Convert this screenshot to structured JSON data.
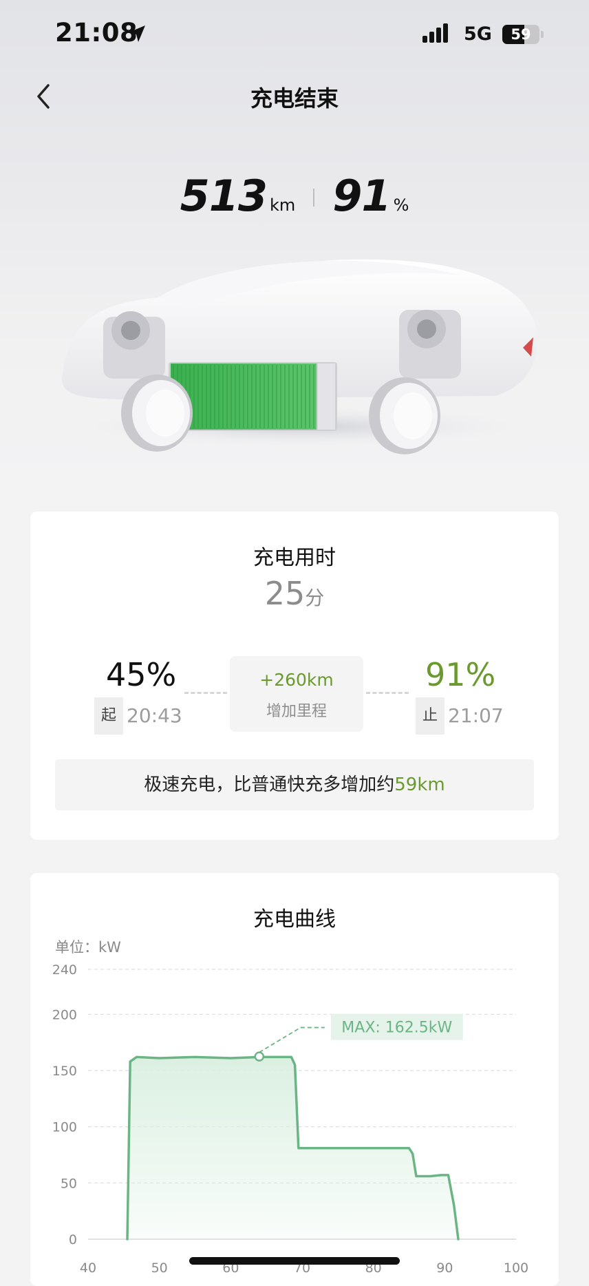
{
  "status_bar": {
    "time": "21:08",
    "network": "5G",
    "battery": "59",
    "battery_level": 0.59
  },
  "header": {
    "title": "充电结束"
  },
  "summary": {
    "range_value": "513",
    "range_unit": "km",
    "soc_value": "91",
    "soc_unit": "%"
  },
  "session": {
    "title": "充电用时",
    "duration_value": "25",
    "duration_unit": "分",
    "start": {
      "soc": "45%",
      "tag": "起",
      "time": "20:43"
    },
    "gain": {
      "value": "+260km",
      "label": "增加里程"
    },
    "end": {
      "soc": "91%",
      "tag": "止",
      "time": "21:07"
    },
    "bonus": {
      "text": "极速充电，比普通快充多增加约",
      "highlight": "59km"
    }
  },
  "chart": {
    "title": "充电曲线",
    "unit_label": "单位：kW",
    "max_label": "MAX: 162.5kW"
  },
  "chart_data": {
    "type": "area",
    "x": [
      45.5,
      45.9,
      46.8,
      50,
      55,
      60,
      64,
      66,
      68.5,
      69.0,
      69.5,
      75,
      80,
      85,
      85.5,
      86,
      88,
      89.5,
      90.5,
      91.3,
      91.9
    ],
    "y": [
      0,
      158,
      162,
      161,
      162,
      161,
      162,
      162,
      162,
      155,
      81,
      81,
      81,
      81,
      76,
      56,
      56,
      57,
      57,
      30,
      0
    ],
    "xlim": [
      40,
      100
    ],
    "ylim": [
      0,
      240
    ],
    "x_ticks": [
      40,
      50,
      60,
      70,
      80,
      90,
      100
    ],
    "y_ticks": [
      0,
      50,
      100,
      150,
      200,
      240
    ],
    "max_point": {
      "x": 64,
      "y": 162.5
    },
    "grid": true,
    "line_color": "#6bb585",
    "fill_color": "#d9efe0"
  },
  "colors": {
    "accent_green": "#6a9a2d",
    "chart_green": "#6bb585",
    "battery_green": "#3fb552"
  }
}
